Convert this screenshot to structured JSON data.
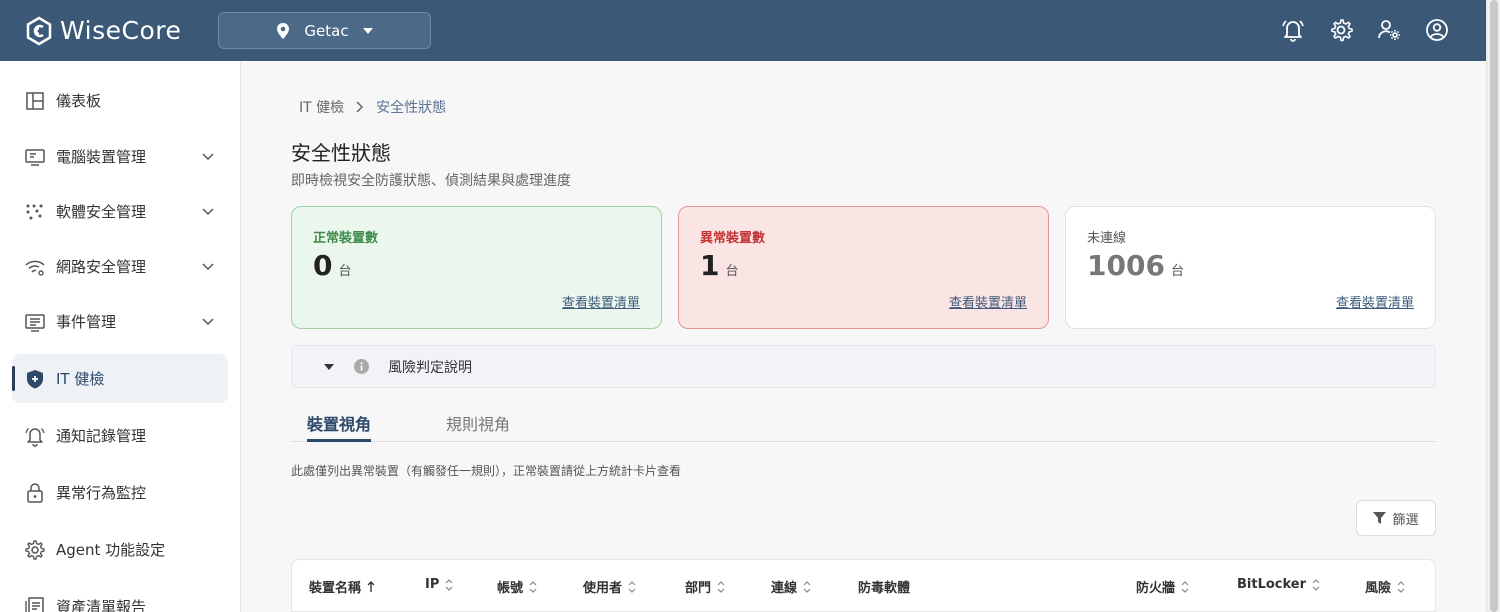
{
  "header": {
    "brand": "WiseCore",
    "site": "Getac"
  },
  "sidebar": {
    "items": [
      {
        "label": "儀表板"
      },
      {
        "label": "電腦裝置管理"
      },
      {
        "label": "軟體安全管理"
      },
      {
        "label": "網路安全管理"
      },
      {
        "label": "事件管理"
      },
      {
        "label": "IT 健檢"
      },
      {
        "label": "通知記錄管理"
      },
      {
        "label": "異常行為監控"
      },
      {
        "label": "Agent 功能設定"
      },
      {
        "label": "資產清單報告"
      }
    ]
  },
  "main": {
    "breadcrumb": {
      "parent": "IT 健檢",
      "current": "安全性狀態"
    },
    "title": "安全性狀態",
    "subtitle": "即時檢視安全防護狀態、偵測結果與處理進度",
    "cards": {
      "normal": {
        "title": "正常裝置數",
        "value": "0",
        "unit": "台",
        "link": "查看裝置清單"
      },
      "abnormal": {
        "title": "異常裝置數",
        "value": "1",
        "unit": "台",
        "link": "查看裝置清單"
      },
      "offline": {
        "title": "未連線",
        "value": "1006",
        "unit": "台",
        "link": "查看裝置清單"
      }
    },
    "risk_label": "風險判定說明",
    "tabs": [
      "裝置視角",
      "規則視角"
    ],
    "note": "此處僅列出異常裝置（有觸發任一規則），正常裝置請從上方統計卡片查看",
    "filter_label": "篩選",
    "table_headers": [
      "裝置名稱",
      "IP",
      "帳號",
      "使用者",
      "部門",
      "連線",
      "防毒軟體",
      "防火牆",
      "BitLocker",
      "風險"
    ]
  },
  "colors": {
    "header_bg": "#3b5877",
    "accent": "#2d4a6b",
    "normal_bg": "#ebf6ed",
    "abnormal_bg": "#fbe4e4"
  }
}
